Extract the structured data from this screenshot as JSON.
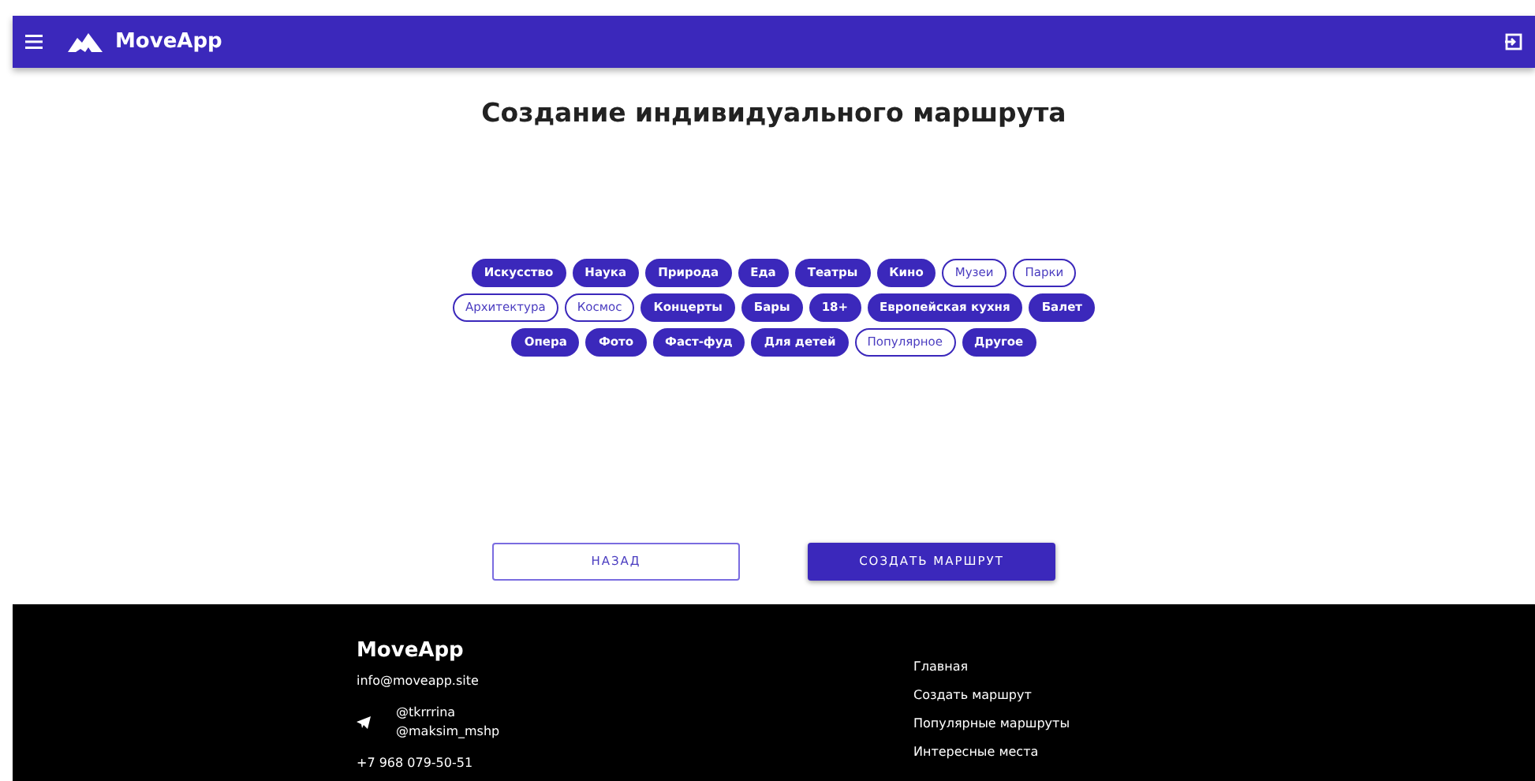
{
  "app_bar": {
    "title": "MoveApp"
  },
  "page_title": "Создание индивидуального маршрута",
  "tag_rows": [
    [
      {
        "label": "Искусство",
        "selected": true
      },
      {
        "label": "Наука",
        "selected": true
      },
      {
        "label": "Природа",
        "selected": true
      },
      {
        "label": "Еда",
        "selected": true
      },
      {
        "label": "Театры",
        "selected": true
      },
      {
        "label": "Кино",
        "selected": true
      },
      {
        "label": "Музеи",
        "selected": false
      },
      {
        "label": "Парки",
        "selected": false
      }
    ],
    [
      {
        "label": "Архитектура",
        "selected": false
      },
      {
        "label": "Космос",
        "selected": false
      },
      {
        "label": "Концерты",
        "selected": true
      },
      {
        "label": "Бары",
        "selected": true
      },
      {
        "label": "18+",
        "selected": true
      },
      {
        "label": "Европейская кухня",
        "selected": true
      },
      {
        "label": "Балет",
        "selected": true
      }
    ],
    [
      {
        "label": "Опера",
        "selected": true
      },
      {
        "label": "Фото",
        "selected": true
      },
      {
        "label": "Фаст-фуд",
        "selected": true
      },
      {
        "label": "Для детей",
        "selected": true
      },
      {
        "label": "Популярное",
        "selected": false
      },
      {
        "label": "Другое",
        "selected": true
      }
    ]
  ],
  "buttons": {
    "back": "НАЗАД",
    "create": "СОЗДАТЬ МАРШРУТ"
  },
  "footer": {
    "brand": "MoveApp",
    "email": "info@moveapp.site",
    "telegram": [
      "@tkrrrina",
      "@maksim_mshp"
    ],
    "phone": "+7 968 079-50-51",
    "links": [
      "Главная",
      "Создать маршрут",
      "Популярные маршруты",
      "Интересные места"
    ]
  }
}
